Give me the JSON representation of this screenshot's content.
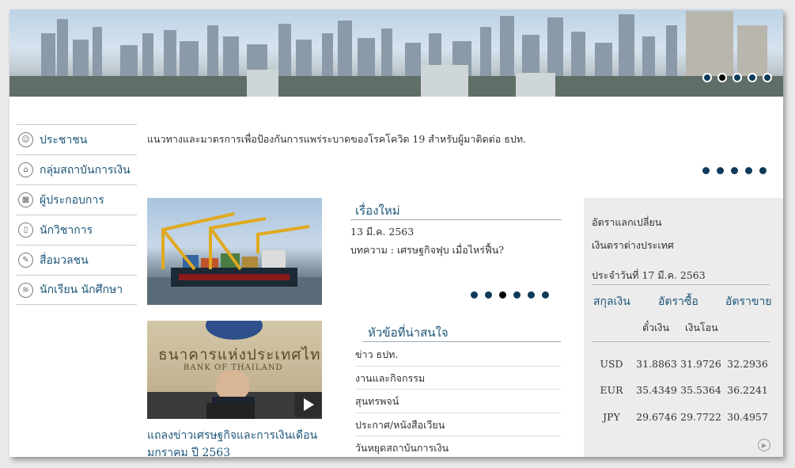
{
  "sidebar": {
    "items": [
      {
        "label": "ประชาชน",
        "icon": "person-icon",
        "glyph": "☺"
      },
      {
        "label": "กลุ่มสถาบันการเงิน",
        "icon": "bank-icon",
        "glyph": "⌂"
      },
      {
        "label": "ผู้ประกอบการ",
        "icon": "building-icon",
        "glyph": "▦"
      },
      {
        "label": "นักวิชาการ",
        "icon": "book-icon",
        "glyph": "▯"
      },
      {
        "label": "สื่อมวลชน",
        "icon": "microphone-icon",
        "glyph": "✎"
      },
      {
        "label": "นักเรียน นักศึกษา",
        "icon": "graduation-cap-icon",
        "glyph": "≋"
      }
    ]
  },
  "notice": {
    "text": "แนวทางและมาตรการเพื่อป้องกันการแพร่ระบาดของโรคโควิด 19 สำหรับผู้มาติดต่อ ธปท."
  },
  "news": {
    "title": "เรื่องใหม่",
    "date": "13 มี.ค. 2563",
    "text": "บทความ : เศรษฐกิจฟุบ เมื่อไหร่ฟื้น?"
  },
  "topics": {
    "title": "หัวข้อที่น่าสนใจ",
    "items": [
      "ข่าว ธปท.",
      "งานและกิจกรรม",
      "สุนทรพจน์",
      "ประกาศ/หนังสือเวียน",
      "วันหยุดสถาบันการเงิน"
    ]
  },
  "video": {
    "caption": "แถลงข่าวเศรษฐกิจและการเงินเดือน",
    "caption2": "มกราคม ปี 2563",
    "sign_text": "ธนาคารแห่งประเทศไทย",
    "sign_en": "BANK OF THAILAND"
  },
  "fx": {
    "title1": "อัตราแลกเปลี่ยน",
    "title2": "เงินตราต่างประเทศ",
    "date": "ประจำวันที่ 17 มี.ค. 2563",
    "col_currency": "สกุลเงิน",
    "col_buy": "อัตราซื้อ",
    "col_sell": "อัตราขาย",
    "sub_cheque": "ตั๋วเงิน",
    "sub_transfer": "เงินโอน",
    "rows": [
      {
        "currency": "USD",
        "cheque": "31.8863",
        "transfer": "31.9726",
        "sell": "32.2936"
      },
      {
        "currency": "EUR",
        "cheque": "35.4349",
        "transfer": "35.5364",
        "sell": "36.2241"
      },
      {
        "currency": "JPY",
        "cheque": "29.6746",
        "transfer": "29.7722",
        "sell": "30.4957"
      }
    ]
  },
  "colors": {
    "accent": "#1d5679",
    "dot": "#0e3a5a"
  }
}
